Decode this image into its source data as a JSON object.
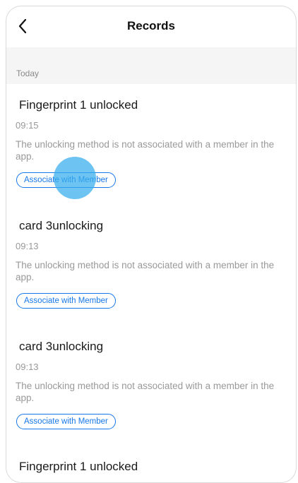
{
  "header": {
    "title": "Records",
    "back_icon": "chevron-left-icon"
  },
  "section": {
    "label": "Today"
  },
  "records": [
    {
      "title": "Fingerprint 1 unlocked",
      "time": "09:15",
      "note": "The unlocking method is not associated with a member in the app.",
      "action_label": "Associate with Member"
    },
    {
      "title": "card 3unlocking",
      "time": "09:13",
      "note": "The unlocking method is not associated with a member in the app.",
      "action_label": "Associate with Member"
    },
    {
      "title": "card 3unlocking",
      "time": "09:13",
      "note": "The unlocking method is not associated with a member in the app.",
      "action_label": "Associate with Member"
    },
    {
      "title": "Fingerprint 1 unlocked"
    }
  ],
  "colors": {
    "accent": "#1677e8",
    "touch_indicator": "#34aceb",
    "section_background": "#f5f5f5"
  }
}
